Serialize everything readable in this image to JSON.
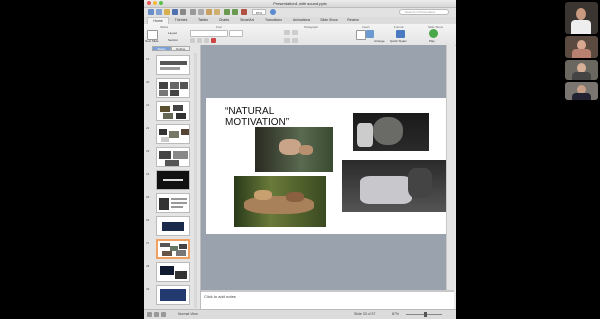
{
  "window": {
    "title": "Presentation1 with sound.pptx"
  },
  "toolbar": {
    "zoom": "87%",
    "search_placeholder": "Search in Presentation"
  },
  "tabs": [
    "Home",
    "Themes",
    "Tables",
    "Charts",
    "SmartArt",
    "Transitions",
    "Animations",
    "Slide Show",
    "Review"
  ],
  "ribbon": {
    "groups": [
      "Slides",
      "Font",
      "Paragraph",
      "Insert",
      "Format",
      "Slide Show"
    ],
    "new_slide": "New Slide",
    "layout": "Layout",
    "section": "Section",
    "arrange": "Arrange",
    "quick_styles": "Quick Styles",
    "play": "Play"
  },
  "panel": {
    "tab_slides": "Slides",
    "tab_outline": "Outline"
  },
  "thumbnails": [
    {
      "num": "19"
    },
    {
      "num": "20"
    },
    {
      "num": "21"
    },
    {
      "num": "22"
    },
    {
      "num": "23"
    },
    {
      "num": "24"
    },
    {
      "num": "25"
    },
    {
      "num": "26"
    },
    {
      "num": "27"
    },
    {
      "num": "28"
    },
    {
      "num": "29"
    }
  ],
  "slide": {
    "title": "“NATURAL MOTIVATION”"
  },
  "notes": {
    "placeholder": "Click to add notes"
  },
  "status": {
    "view": "Normal View",
    "slide_of": "Slide 33 of 37",
    "zoom": "87%"
  },
  "colors": {
    "selection": "#f0a060",
    "canvas": "#9aa2ae"
  }
}
